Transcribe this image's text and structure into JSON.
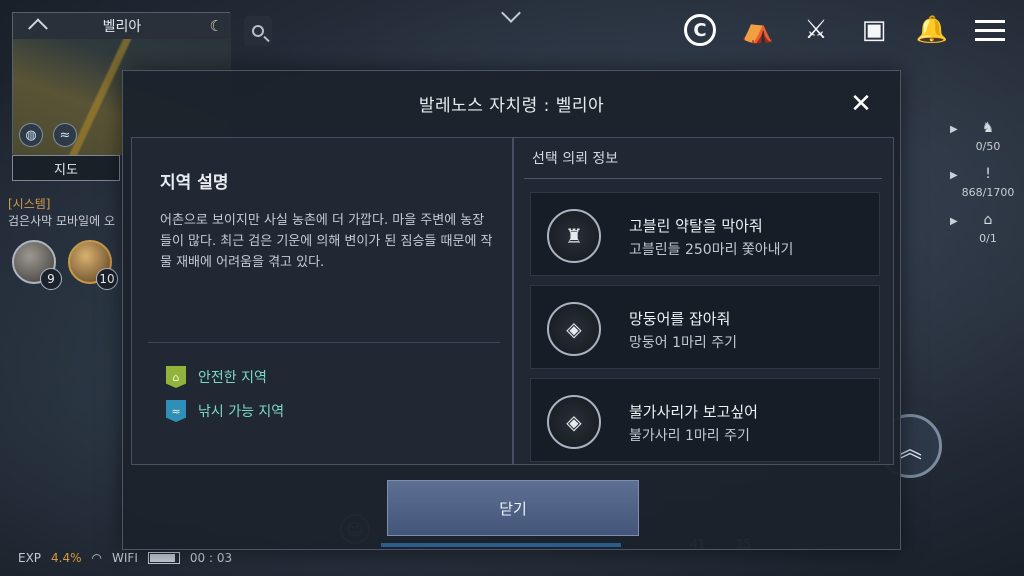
{
  "minimap": {
    "region_name": "벨리아",
    "map_button": "지도"
  },
  "chat": {
    "system_label": "[시스템]",
    "system_message": "검은사막 모바일에 오"
  },
  "party": [
    {
      "level": "9"
    },
    {
      "level": "10"
    }
  ],
  "hud": {
    "icons": [
      "copyright-icon",
      "camp-tent-icon",
      "crossed-axes-icon",
      "inventory-bag-icon",
      "bell-icon",
      "menu-icon"
    ]
  },
  "trackers": [
    {
      "icon": "boss-helmet-icon",
      "value": "0/50"
    },
    {
      "icon": "exclamation-icon",
      "value": "868/1700"
    },
    {
      "icon": "house-icon",
      "value": "0/1"
    }
  ],
  "bottom_bar": {
    "exp_label": "EXP",
    "exp_value": "4.4%",
    "wifi_label": "WIFI",
    "battery_level": 0.9,
    "time": "00 : 03",
    "left_count": "41",
    "right_count": "15"
  },
  "modal": {
    "title": "발레노스 자치령 : 벨리아",
    "left": {
      "heading": "지역 설명",
      "description": "어촌으로 보이지만 사실 농촌에 더 가깝다. 마을 주변에 농장들이 많다. 최근 검은 기운에 의해 변이가 된 짐승들 때문에 작물 재배에 어려움을 겪고 있다.",
      "features": [
        {
          "label": "안전한 지역",
          "icon": "safe-zone-icon"
        },
        {
          "label": "낚시 가능 지역",
          "icon": "fishing-zone-icon"
        }
      ]
    },
    "right": {
      "heading": "선택 의뢰 정보",
      "quests": [
        {
          "title": "고블린 약탈을 막아줘",
          "subtitle": "고블린들 250마리 쫓아내기",
          "icon": "goblin-helmet-icon"
        },
        {
          "title": "망둥어를 잡아줘",
          "subtitle": "망둥어 1마리 주기",
          "icon": "diamond-item-icon"
        },
        {
          "title": "불가사리가 보고싶어",
          "subtitle": "불가사리 1마리 주기",
          "icon": "diamond-item-icon"
        }
      ]
    },
    "close_button": "닫기"
  }
}
